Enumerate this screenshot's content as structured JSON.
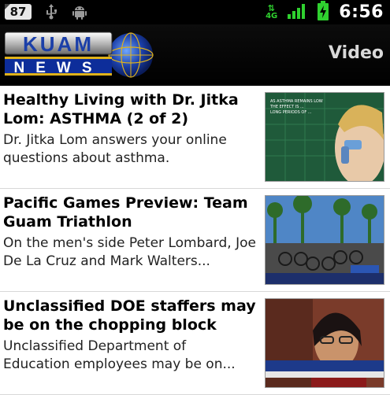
{
  "status_bar": {
    "notification_count": "87",
    "network": "4G",
    "clock": "6:56",
    "icons": [
      "usb-icon",
      "android-debug-icon",
      "network-4g-icon",
      "signal-icon",
      "battery-charging-icon"
    ]
  },
  "header": {
    "logo_line1": "KUAM",
    "logo_line2": "NEWS",
    "section_title": "Video"
  },
  "articles": [
    {
      "headline": "Healthy Living with Dr. Jitka Lom: ASTHMA (2 of 2)",
      "summary": "Dr. Jitka Lom answers your online questions about asthma.",
      "thumbnail_icon": "asthma-video-thumbnail",
      "thumbnail_overlay": "AS ASTHMA REMAINS LOW / THE EFFECT IS ... / LONG PERIODS OF ..."
    },
    {
      "headline": "Pacific Games Preview: Team Guam Triathlon",
      "summary": "On the men's side Peter Lombard, Joe De La Cruz and Mark Walters...",
      "thumbnail_icon": "triathlon-video-thumbnail"
    },
    {
      "headline": "Unclassified DOE staffers may be on the chopping block",
      "summary": "Unclassified Department of Education employees may be on...",
      "thumbnail_icon": "doe-video-thumbnail"
    }
  ],
  "colors": {
    "status_bar_bg": "#000000",
    "header_bg": "#000000",
    "network_green": "#2fd12f",
    "logo_blue": "#1b3fa8",
    "logo_gold": "#e0b21a"
  }
}
